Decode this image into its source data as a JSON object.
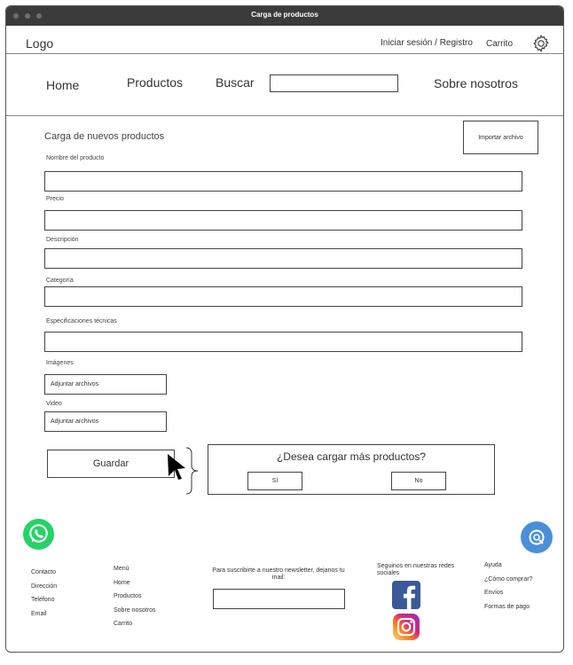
{
  "window": {
    "title": "Carga de productos"
  },
  "header": {
    "logo": "Logo",
    "login": "Iniciar sesión / Registro",
    "cart": "Carrito",
    "settings_icon": "gear-icon"
  },
  "nav": {
    "home": "Home",
    "products": "Productos",
    "search": "Buscar",
    "search_value": "",
    "about": "Sobre nosotros"
  },
  "form": {
    "title": "Carga de nuevos productos",
    "import_button": "Importar archivo",
    "fields": [
      {
        "label": "Nombre del producto",
        "value": ""
      },
      {
        "label": "Precio",
        "value": ""
      },
      {
        "label": "Descripción",
        "value": ""
      },
      {
        "label": "Categoría",
        "value": ""
      },
      {
        "label": "Especificaciones técnicas",
        "value": ""
      }
    ],
    "images_label": "Imágenes",
    "images_button": "Adjuntar archivos",
    "video_label": "Video",
    "video_button": "Adjuntar archivos",
    "save_button": "Guardar"
  },
  "dialog": {
    "question": "¿Desea cargar más productos?",
    "yes": "Sí",
    "no": "No"
  },
  "footer": {
    "contact": [
      "Contacto",
      "Dirección",
      "Teléfono",
      "Email"
    ],
    "menu": [
      "Menú",
      "Home",
      "Productos",
      "Sobre nosotros",
      "Carrito"
    ],
    "newsletter_text": "Para suscribirte a nuestro newsletter, dejanos tu mail:",
    "social_title": "Seguinos en nuestras redes sociales",
    "help": [
      "Ayuda",
      "¿Cómo comprar?",
      "Envíos",
      "Formas de pago"
    ]
  },
  "colors": {
    "titlebar": "#3b3b3b",
    "whatsapp": "#25d366",
    "chat": "#4a90d9",
    "facebook": "#3b5998",
    "instagram_from": "#feda75",
    "instagram_to": "#962fbf"
  }
}
